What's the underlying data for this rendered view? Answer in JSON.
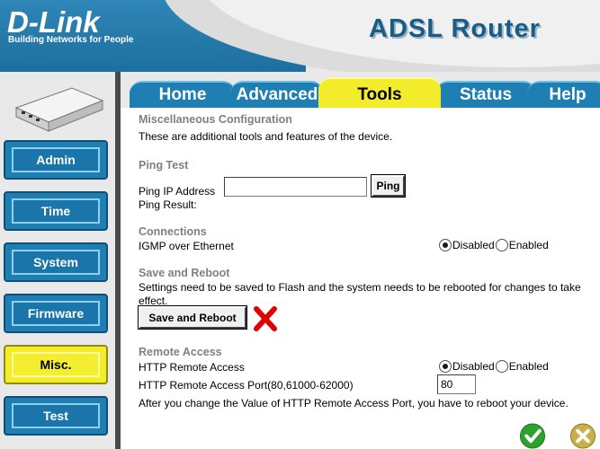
{
  "header": {
    "logo": "D-Link",
    "tagline": "Building Networks for People",
    "product": "ADSL Router"
  },
  "sidebar": {
    "items": [
      {
        "label": "Admin"
      },
      {
        "label": "Time"
      },
      {
        "label": "System"
      },
      {
        "label": "Firmware"
      },
      {
        "label": "Misc.",
        "active": true
      },
      {
        "label": "Test"
      }
    ]
  },
  "tabs": [
    {
      "label": "Home"
    },
    {
      "label": "Advanced"
    },
    {
      "label": "Tools",
      "active": true
    },
    {
      "label": "Status"
    },
    {
      "label": "Help"
    }
  ],
  "main": {
    "title": "Miscellaneous Configuration",
    "description": "These are additional tools and features of the device.",
    "ping": {
      "section_title": "Ping Test",
      "ip_label": "Ping IP Address",
      "ip_value": "",
      "button_label": "Ping",
      "result_label": "Ping Result:"
    },
    "connections": {
      "section_title": "Connections",
      "igmp_label": "IGMP over Ethernet",
      "option_disabled": "Disabled",
      "option_enabled": "Enabled",
      "selected": "Disabled"
    },
    "save_reboot": {
      "section_title": "Save and Reboot",
      "text": "Settings need to be saved to Flash and the system needs to be rebooted for changes to take effect.",
      "button_label": "Save and Reboot"
    },
    "remote_access": {
      "section_title": "Remote Access",
      "http_label": "HTTP Remote Access",
      "option_disabled": "Disabled",
      "option_enabled": "Enabled",
      "selected": "Disabled",
      "port_label": "HTTP Remote Access Port(80,61000-62000)",
      "port_value": "80",
      "note": "After you change the Value of HTTP Remote Access Port, you have to reboot your device."
    }
  },
  "colors": {
    "brand_blue": "#1f7fb3",
    "active_yellow": "#f3ec2a",
    "section_gray": "#808080",
    "cancel_red": "#e00000",
    "apply_green": "#2fa12f"
  },
  "icons": {
    "cancel_mark": "red-x-icon",
    "apply": "green-check-icon",
    "cancel": "cancel-x-icon"
  }
}
